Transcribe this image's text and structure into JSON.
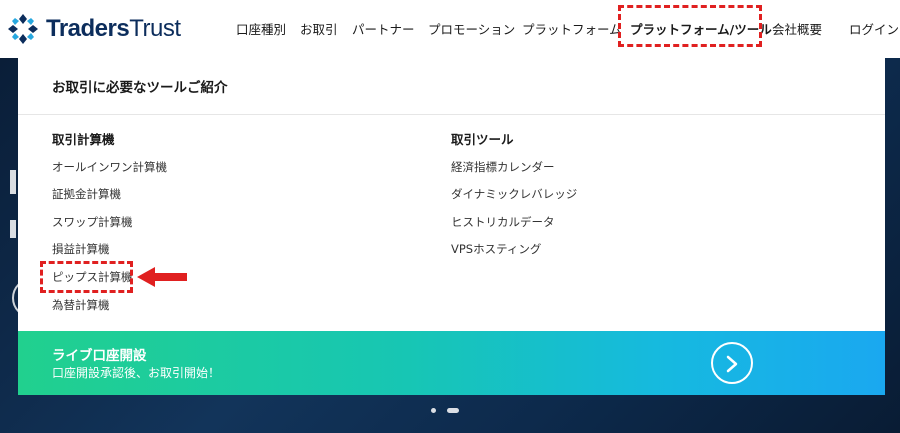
{
  "brand": {
    "logo_text_bold": "Traders",
    "logo_text_light": "Trust",
    "color": "#0c2d5c"
  },
  "nav": {
    "items": [
      {
        "label": "口座種別"
      },
      {
        "label": "お取引"
      },
      {
        "label": "パートナー"
      },
      {
        "label": "プロモーション"
      },
      {
        "label": "プラットフォーム"
      },
      {
        "label": "プラットフォーム/ツール",
        "active": true
      },
      {
        "label": "会社概要"
      }
    ],
    "login": "ログイン"
  },
  "dropdown": {
    "title": "お取引に必要なツールご紹介",
    "columns": [
      {
        "heading": "取引計算機",
        "links": [
          "オールインワン計算機",
          "証拠金計算機",
          "スワップ計算機",
          "損益計算機",
          "ピップス計算機",
          "為替計算機"
        ]
      },
      {
        "heading": "取引ツール",
        "links": [
          "経済指標カレンダー",
          "ダイナミックレバレッジ",
          "ヒストリカルデータ",
          "VPSホスティング"
        ]
      }
    ],
    "cta": {
      "title": "ライブ口座開設",
      "subtitle": "口座開設承認後、お取引開始！"
    }
  },
  "annotations": {
    "highlight_color": "#e02020",
    "arrow_icon": "left-arrow-icon"
  },
  "icons": {
    "cta_button": "chevron-right-icon",
    "logo": "traders-trust-logo-icon"
  }
}
